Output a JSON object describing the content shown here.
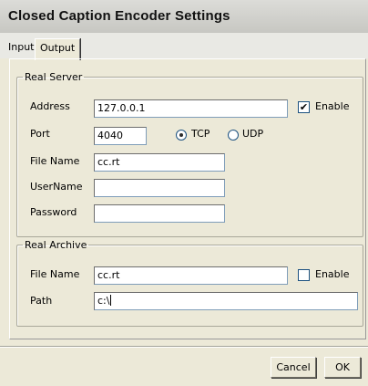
{
  "window": {
    "title": "Closed Caption Encoder Settings"
  },
  "tabs": [
    {
      "label": "Input"
    },
    {
      "label": "Output"
    }
  ],
  "real_server": {
    "legend": "Real Server",
    "address_label": "Address",
    "address_value": "127.0.0.1",
    "enable_label": "Enable",
    "enable_checked": true,
    "port_label": "Port",
    "port_value": "4040",
    "tcp_label": "TCP",
    "udp_label": "UDP",
    "protocol_selected": "TCP",
    "filename_label": "File Name",
    "filename_value": "cc.rt",
    "username_label": "UserName",
    "username_value": "",
    "password_label": "Password",
    "password_value": ""
  },
  "real_archive": {
    "legend": "Real Archive",
    "filename_label": "File Name",
    "filename_value": "cc.rt",
    "enable_label": "Enable",
    "enable_checked": false,
    "path_label": "Path",
    "path_value": "c:\\"
  },
  "buttons": {
    "cancel": "Cancel",
    "ok": "OK"
  }
}
